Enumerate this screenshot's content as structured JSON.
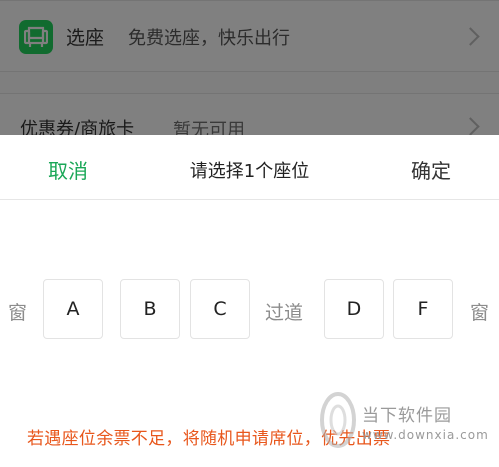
{
  "background": {
    "seat_row": {
      "title": "选座",
      "subtitle": "免费选座，快乐出行",
      "icon": "sofa-icon"
    },
    "coupon_row": {
      "title": "优惠券/商旅卡",
      "value": "暂无可用"
    }
  },
  "sheet": {
    "cancel_label": "取消",
    "title": "请选择1个座位",
    "confirm_label": "确定",
    "window_left": "窗",
    "aisle": "过道",
    "window_right": "窗",
    "seats": [
      "A",
      "B",
      "C",
      "D",
      "F"
    ],
    "notice": "若遇座位余票不足，将随机申请席位，优先出票"
  },
  "watermark": {
    "name": "当下软件园",
    "url": "www.downxia.com"
  },
  "colors": {
    "accent": "#1aa757",
    "notice": "#e8571c",
    "overlay": "#7f7f7f"
  }
}
